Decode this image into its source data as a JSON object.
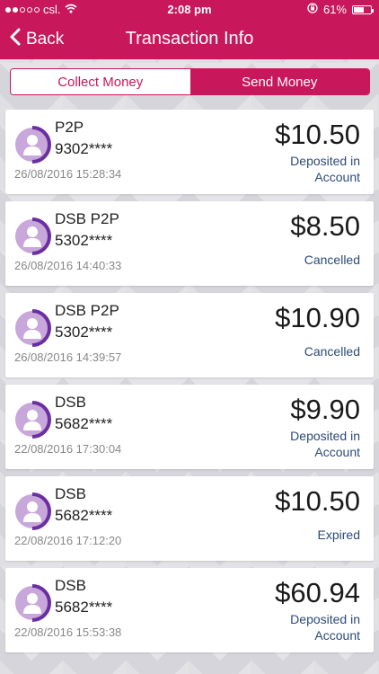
{
  "status_bar": {
    "carrier": "csl.",
    "time": "2:08 pm",
    "battery": "61%",
    "battery_level": 0.61,
    "icons": [
      "signal-dots-icon",
      "wifi-icon",
      "orientation-lock-icon",
      "battery-icon"
    ]
  },
  "nav": {
    "back_label": "Back",
    "title": "Transaction Info"
  },
  "tabs": {
    "collect": "Collect Money",
    "send": "Send Money",
    "selected": "send"
  },
  "colors": {
    "brand": "#c8175a",
    "status_text": "#2b4a78",
    "avatar_purple": "#6a2fa0"
  },
  "transactions": [
    {
      "name": "P2P",
      "account": "9302****",
      "datetime": "26/08/2016 15:28:34",
      "amount": "$10.50",
      "status": "Deposited in Account"
    },
    {
      "name": "DSB P2P",
      "account": "5302****",
      "datetime": "26/08/2016 14:40:33",
      "amount": "$8.50",
      "status": "Cancelled"
    },
    {
      "name": "DSB P2P",
      "account": "5302****",
      "datetime": "26/08/2016 14:39:57",
      "amount": "$10.90",
      "status": "Cancelled"
    },
    {
      "name": "DSB",
      "account": "5682****",
      "datetime": "22/08/2016 17:30:04",
      "amount": "$9.90",
      "status": "Deposited in Account"
    },
    {
      "name": "DSB",
      "account": "5682****",
      "datetime": "22/08/2016 17:12:20",
      "amount": "$10.50",
      "status": "Expired"
    },
    {
      "name": "DSB",
      "account": "5682****",
      "datetime": "22/08/2016 15:53:38",
      "amount": "$60.94",
      "status": "Deposited in Account"
    }
  ]
}
